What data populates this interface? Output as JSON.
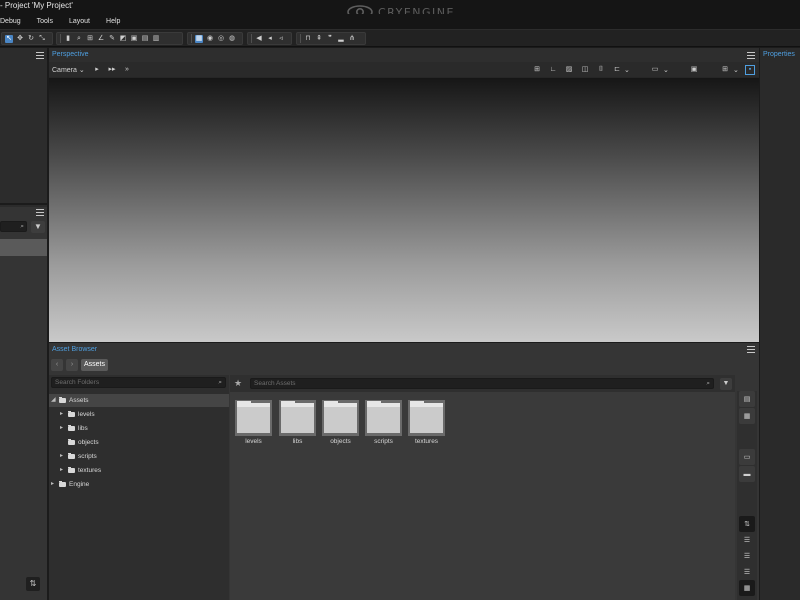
{
  "window": {
    "title": "- Project 'My Project'",
    "logo_text": "CRYENGINE"
  },
  "menu": [
    "Debug",
    "Tools",
    "Layout",
    "Help"
  ],
  "viewport": {
    "title": "Perspective",
    "camera_label": "Camera"
  },
  "properties": {
    "title": "Properties"
  },
  "asset_browser": {
    "title": "Asset Browser",
    "breadcrumb": "Assets",
    "search_folders_placeholder": "Search Folders",
    "search_assets_placeholder": "Search Assets",
    "tree": [
      {
        "label": "Assets",
        "expanded": true
      },
      {
        "label": "levels"
      },
      {
        "label": "libs"
      },
      {
        "label": "objects"
      },
      {
        "label": "scripts"
      },
      {
        "label": "textures"
      },
      {
        "label": "Engine"
      }
    ],
    "folders": [
      "levels",
      "libs",
      "objects",
      "scripts",
      "textures"
    ]
  },
  "colors": {
    "accent": "#4f9fe0",
    "active_tool": "#4a86c5"
  }
}
